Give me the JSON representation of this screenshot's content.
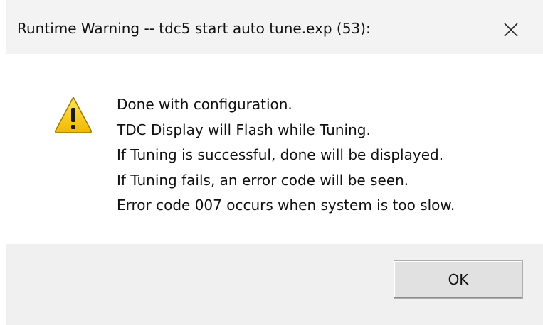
{
  "dialog": {
    "title": "Runtime Warning -- tdc5 start auto tune.exp (53):",
    "close_icon": "close-icon",
    "warning_icon": "warning-icon",
    "message_lines": [
      "Done with configuration.",
      "TDC Display will Flash while Tuning.",
      "If Tuning is successful, done will be displayed.",
      "If Tuning fails, an error code will be seen.",
      "Error code 007 occurs when system is too slow."
    ],
    "ok_label": "OK"
  },
  "colors": {
    "titlebar_bg": "#f3f3f3",
    "content_bg": "#ffffff",
    "footer_bg": "#f0f0f0",
    "warning_yellow": "#f7c600",
    "warning_outline": "#9a7a00",
    "text": "#111111"
  }
}
